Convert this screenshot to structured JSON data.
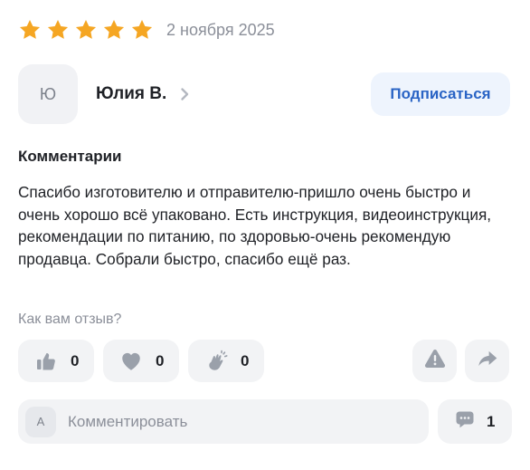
{
  "review": {
    "rating": 5,
    "max_rating": 5,
    "date": "2 ноября 2025",
    "star_color": "#f5a623"
  },
  "author": {
    "avatar_letter": "Ю",
    "name": "Юлия В.",
    "subscribe_label": "Подписаться"
  },
  "comments_section": {
    "heading": "Комментарии",
    "text": "Спасибо изготовителю и отправителю-пришло очень быстро и очень хорошо всё упаковано. Есть инструкция, видеоинструкция, рекомендации по питанию, по здоровью-очень рекомендую продавца. Собрали быстро, спасибо ещё раз."
  },
  "feedback": {
    "question": "Как вам отзыв?",
    "reactions": [
      {
        "icon": "thumbs-up-icon",
        "count": "0"
      },
      {
        "icon": "heart-icon",
        "count": "0"
      },
      {
        "icon": "clapping-hands-icon",
        "count": "0"
      }
    ],
    "report_icon": "warning-icon",
    "share_icon": "share-arrow-icon"
  },
  "comment_bar": {
    "avatar_letter": "А",
    "placeholder": "Комментировать",
    "comments_count": "1",
    "comments_icon": "chat-bubble-icon"
  },
  "colors": {
    "accent": "#2a64c5",
    "accent_bg": "#eef4fd",
    "button_bg": "#f2f3f5",
    "icon_gray": "#9aa0aa",
    "muted_text": "#8b8f99"
  }
}
